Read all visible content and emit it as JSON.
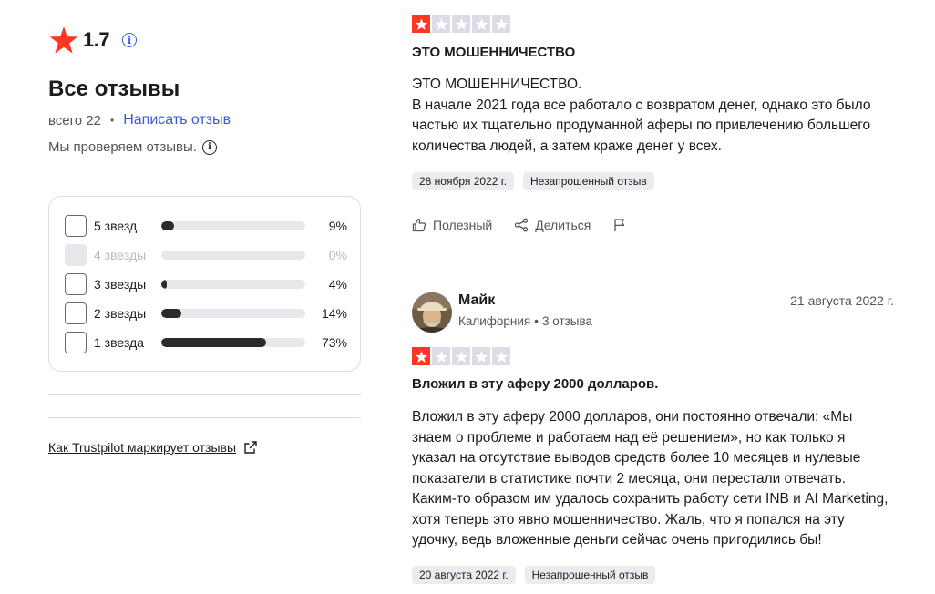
{
  "summary": {
    "rating": "1.7",
    "title": "Все отзывы",
    "total_prefix": "всего",
    "total_count": "22",
    "write_review": "Написать отзыв",
    "verify_text": "Мы проверяем отзывы.",
    "how_link": "Как Trustpilot маркирует отзывы"
  },
  "filters": [
    {
      "label": "5 звезд",
      "percent": "9%",
      "fill": 0.09,
      "disabled": false
    },
    {
      "label": "4 звезды",
      "percent": "0%",
      "fill": 0.0,
      "disabled": true
    },
    {
      "label": "3 звезды",
      "percent": "4%",
      "fill": 0.04,
      "disabled": false
    },
    {
      "label": "2 звезды",
      "percent": "14%",
      "fill": 0.14,
      "disabled": false
    },
    {
      "label": "1 звезда",
      "percent": "73%",
      "fill": 0.73,
      "disabled": false
    }
  ],
  "reviews": [
    {
      "stars": 1,
      "title": "ЭТО МОШЕННИЧЕСТВО",
      "body": [
        "ЭТО МОШЕННИЧЕСТВО.",
        "В начале 2021 года все работало с возвратом денег, однако это было частью их тщательно продуманной аферы по привлечению большего количества людей, а затем краже денег у всех."
      ],
      "date_chip": "28 ноября 2022 г.",
      "tag_chip": "Незапрошенный отзыв",
      "actions": {
        "useful": "Полезный",
        "share": "Делиться"
      }
    },
    {
      "author": "Майк",
      "location": "Калифорния",
      "review_count": "3 отзыва",
      "date": "21 августа 2022 г.",
      "stars": 1,
      "title": "Вложил в эту аферу 2000 долларов.",
      "body": [
        "Вложил в эту аферу 2000 долларов, они постоянно отвечали: «Мы знаем о проблеме и работаем над её решением», но как только я указал на отсутствие выводов средств более 10 месяцев и нулевые показатели в статистике почти 2 месяца, они перестали отвечать. Каким-то образом им удалось сохранить работу сети INB и AI Marketing, хотя теперь это явно мошенничество. Жаль, что я попался на эту удочку, ведь вложенные деньги сейчас очень пригодились бы!"
      ],
      "date_chip": "20 августа 2022 г.",
      "tag_chip": "Незапрошенный отзыв"
    }
  ],
  "colors": {
    "star_red": "#ff3722",
    "star_grey": "#dcdce6",
    "link_blue": "#3a5ad9",
    "bar_fill": "#2b2b2b",
    "chip_bg": "#ececf0"
  },
  "icons": [
    "star-icon",
    "info-icon",
    "thumb-up-icon",
    "share-icon",
    "flag-icon",
    "external-link-icon"
  ]
}
